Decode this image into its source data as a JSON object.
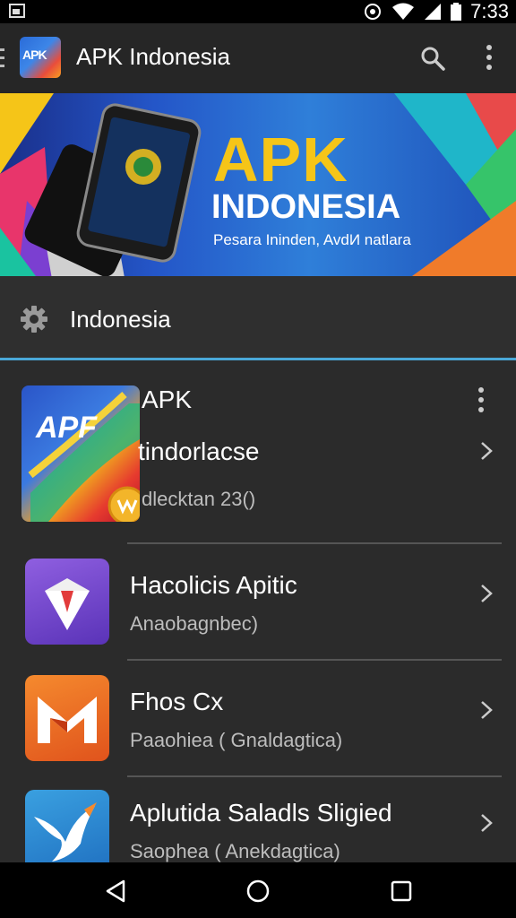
{
  "status_bar": {
    "time": "7:33"
  },
  "app_bar": {
    "title": "APK Indonesia",
    "logo_text": "APK"
  },
  "banner": {
    "title_line1": "APK",
    "title_line2": "INDONESIA",
    "subtitle": "Pesara Ininden, AvdИ natlara"
  },
  "section": {
    "label": "Indonesia"
  },
  "featured": {
    "icon_text": "APF",
    "title_line1": "APK",
    "title_line2": "tindorlacse",
    "subtitle": "dlecktan 23()"
  },
  "list": [
    {
      "title": "Hacolicis Apitic",
      "subtitle": "Anaobagnbec)",
      "icon": "diamond-icon"
    },
    {
      "title": "Fhos Cx",
      "subtitle": "Paaohiea ( Gnaldagtica)",
      "icon": "m-logo-icon"
    },
    {
      "title": "Aplutida Saladls Sligied",
      "subtitle": "Saophea ( Anekdagtica)",
      "icon": "bird-icon"
    }
  ],
  "colors": {
    "accent_line": "#4aa8d8",
    "banner_title": "#f5c518",
    "background": "#2b2b2b"
  }
}
